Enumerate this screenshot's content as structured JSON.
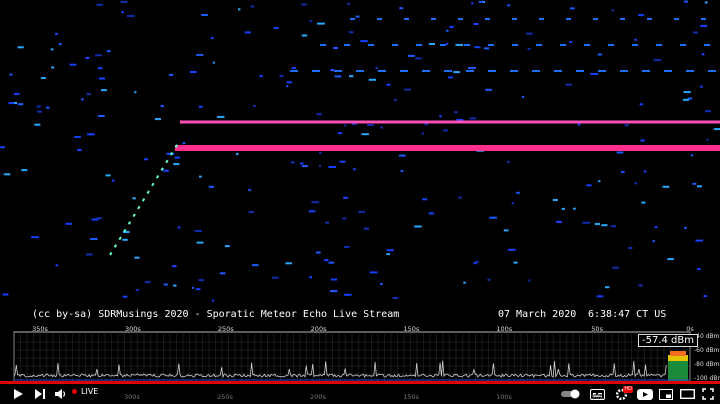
{
  "caption": {
    "credit": "(cc by-sa) SDRMusings 2020 - Sporatic Meteor Echo Live Stream",
    "date": "07 March 2020",
    "time": "6:38:47 CT US"
  },
  "spectrum": {
    "time_ticks": [
      "350s",
      "300s",
      "250s",
      "200s",
      "150s",
      "100s",
      "50s",
      "0s"
    ],
    "db_ticks": [
      "-40 dBm",
      "-60 dBm",
      "-80 dBm",
      "-100 dBm"
    ],
    "readout": "-57.4 dBm"
  },
  "bottom_time_ticks": [
    "300s",
    "250s",
    "200s",
    "150s",
    "100s",
    "50s"
  ],
  "player": {
    "live_label": "LIVE",
    "progress_percent": 100,
    "hd_badge": "HD",
    "accent_color": "#dd0000"
  },
  "icons": {
    "play": "play-icon",
    "next": "next-icon",
    "volume": "volume-icon",
    "autoplay": "autoplay-toggle-icon",
    "captions": "captions-icon",
    "settings": "gear-icon",
    "youtube": "youtube-logo-icon",
    "miniplayer": "miniplayer-icon",
    "theater": "theater-icon",
    "fullscreen": "fullscreen-icon"
  }
}
